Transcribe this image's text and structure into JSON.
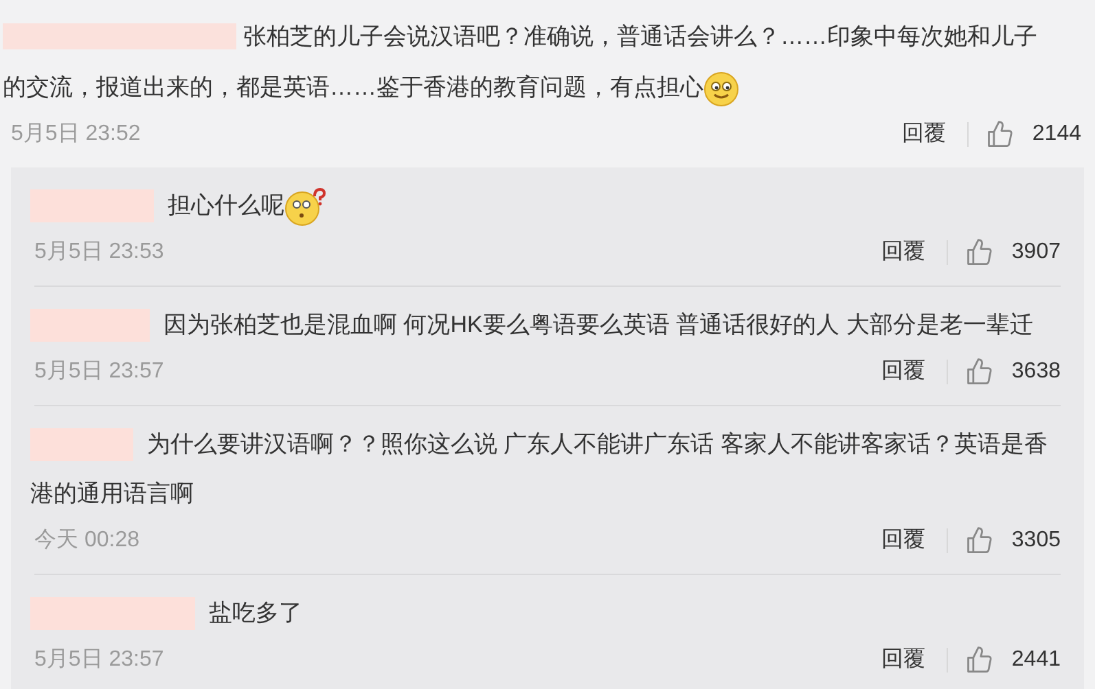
{
  "comment": {
    "text": "张柏芝的儿子会说汉语吧？准确说，普通话会讲么？……印象中每次她和儿子的交流，报道出来的，都是英语……鉴于香港的教育问题，有点担心",
    "emoji": {
      "kind": "smirk"
    },
    "time": "5月5日 23:52",
    "reply_label": "回覆",
    "likes": "2144"
  },
  "replies": [
    {
      "text": "担心什么呢",
      "emoji": {
        "kind": "puzzled"
      },
      "time": "5月5日 23:53",
      "reply_label": "回覆",
      "likes": "3907"
    },
    {
      "text": "因为张柏芝也是混血啊 何况HK要么粤语要么英语 普通话很好的人 大部分是老一辈迁",
      "time": "5月5日 23:57",
      "reply_label": "回覆",
      "likes": "3638"
    },
    {
      "text": "为什么要讲汉语啊？？照你这么说 广东人不能讲广东话 客家人不能讲客家话？英语是香港的通用语言啊",
      "time": "今天 00:28",
      "reply_label": "回覆",
      "likes": "3305"
    },
    {
      "text": "盐吃多了",
      "time": "5月5日 23:57",
      "reply_label": "回覆",
      "likes": "2441"
    }
  ]
}
